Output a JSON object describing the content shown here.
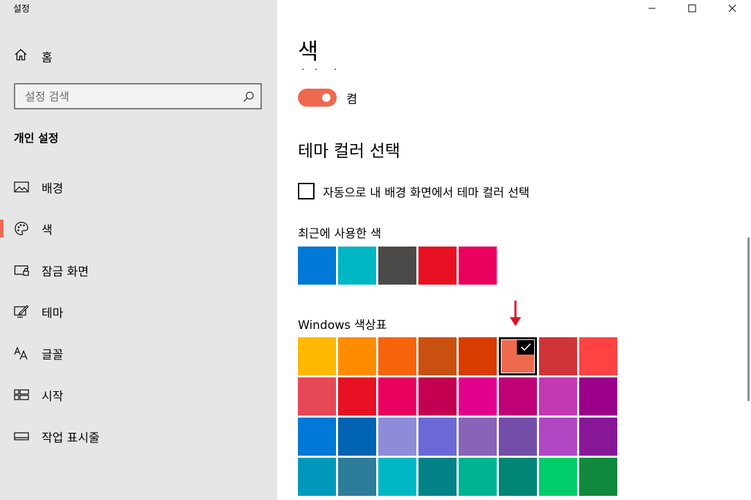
{
  "window": {
    "title": "설정"
  },
  "sidebar": {
    "home_label": "홈",
    "search_placeholder": "설정 검색",
    "section_heading": "개인 설정",
    "items": [
      {
        "label": "배경",
        "icon": "picture-icon"
      },
      {
        "label": "색",
        "icon": "palette-icon",
        "active": true
      },
      {
        "label": "잠금 화면",
        "icon": "lock-screen-icon"
      },
      {
        "label": "테마",
        "icon": "theme-icon"
      },
      {
        "label": "글꼴",
        "icon": "font-icon"
      },
      {
        "label": "시작",
        "icon": "start-icon"
      },
      {
        "label": "작업 표시줄",
        "icon": "taskbar-icon"
      }
    ]
  },
  "main": {
    "title": "색",
    "transparency_toggle": {
      "state_label": "켬",
      "on": true
    },
    "theme_color_heading": "테마 컬러 선택",
    "auto_checkbox_label": "자동으로 내 배경 화면에서 테마 컬러 선택",
    "auto_checkbox_checked": false,
    "recent_label": "최근에 사용한 색",
    "recent_colors": [
      "#0078d7",
      "#00b7c3",
      "#4c4a48",
      "#e81123",
      "#ea005e"
    ],
    "palette_label": "Windows 색상표",
    "palette_colors": [
      "#ffb900",
      "#ff8c00",
      "#f7630c",
      "#ca5010",
      "#da3b01",
      "#ef6950",
      "#d13438",
      "#ff4343",
      "#e74856",
      "#e81123",
      "#ea005e",
      "#c30052",
      "#e3008c",
      "#bf0077",
      "#c239b3",
      "#9a0089",
      "#0078d7",
      "#0063b1",
      "#8e8cd8",
      "#6b69d6",
      "#8764b8",
      "#744da9",
      "#b146c2",
      "#881798",
      "#0099bc",
      "#2d7d9a",
      "#00b7c3",
      "#038387",
      "#00b294",
      "#018574",
      "#00cc6a",
      "#10893e"
    ],
    "selected_palette_index": 5,
    "accent_color": "#ef6950"
  }
}
